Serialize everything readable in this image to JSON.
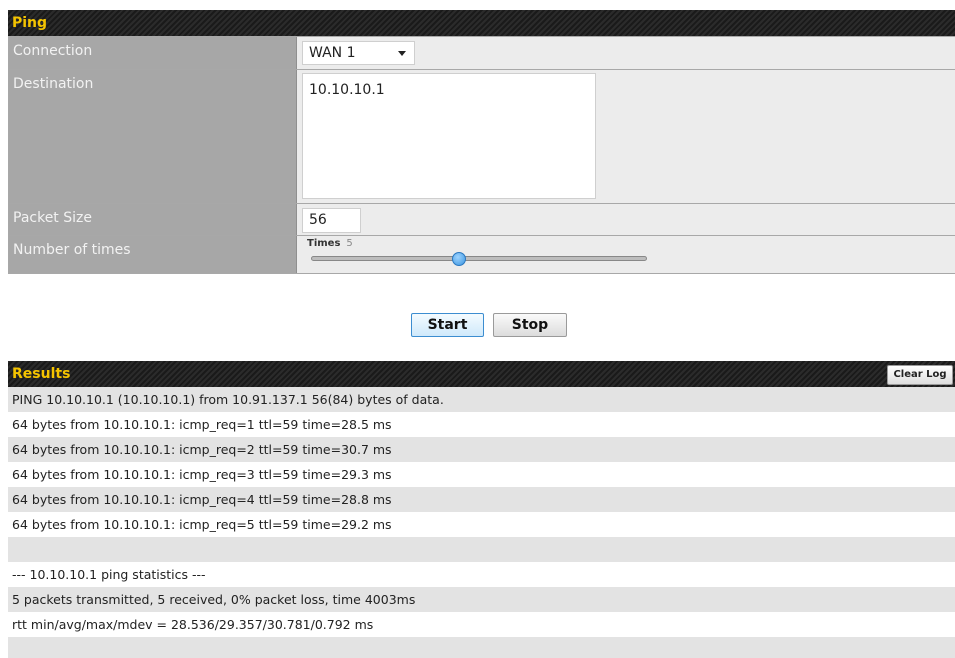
{
  "ping": {
    "title": "Ping",
    "connection": {
      "label": "Connection",
      "value": "WAN 1"
    },
    "destination": {
      "label": "Destination",
      "value": "10.10.10.1"
    },
    "packet_size": {
      "label": "Packet Size",
      "value": "56"
    },
    "number_of_times": {
      "label": "Number of times",
      "caption": "Times",
      "value": "5",
      "slider_fraction": 0.44
    }
  },
  "buttons": {
    "start": "Start",
    "stop": "Stop"
  },
  "results": {
    "title": "Results",
    "clear_log": "Clear Log",
    "lines": [
      "PING 10.10.10.1 (10.10.10.1) from 10.91.137.1 56(84) bytes of data.",
      "64 bytes from 10.10.10.1: icmp_req=1 ttl=59 time=28.5 ms",
      "64 bytes from 10.10.10.1: icmp_req=2 ttl=59 time=30.7 ms",
      "64 bytes from 10.10.10.1: icmp_req=3 ttl=59 time=29.3 ms",
      "64 bytes from 10.10.10.1: icmp_req=4 ttl=59 time=28.8 ms",
      "64 bytes from 10.10.10.1: icmp_req=5 ttl=59 time=29.2 ms",
      "",
      "--- 10.10.10.1 ping statistics ---",
      "5 packets transmitted, 5 received, 0% packet loss, time 4003ms",
      "rtt min/avg/max/mdev = 28.536/29.357/30.781/0.792 ms",
      ""
    ]
  },
  "colors": {
    "header_text": "#f5c400",
    "label_bg": "#a7a7a7",
    "value_bg": "#ececec",
    "start_border": "#3c8dd0",
    "slider_knob": "#3a95e0"
  }
}
